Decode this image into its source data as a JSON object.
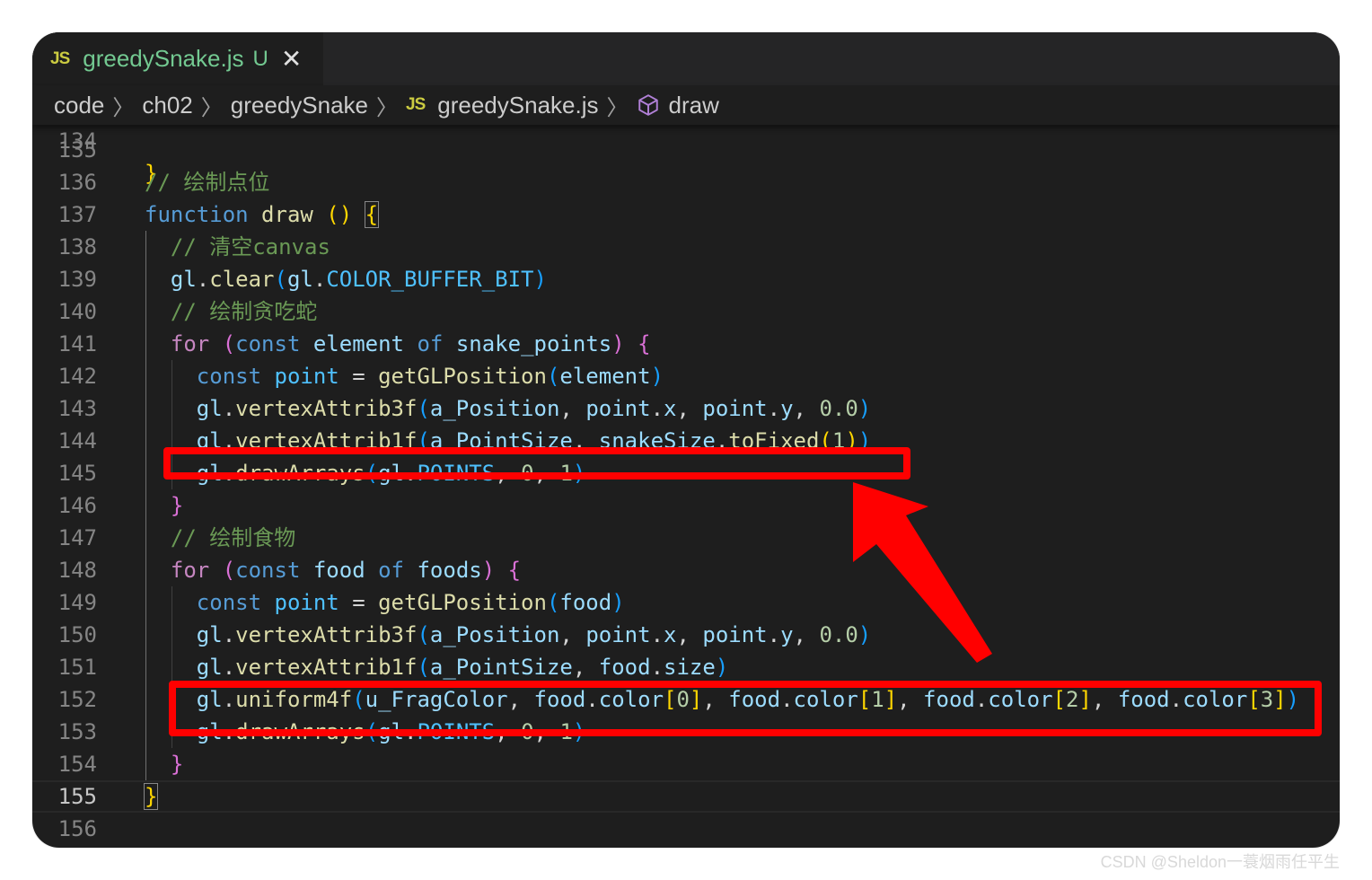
{
  "tab": {
    "icon": "JS",
    "filename": "greedySnake.js",
    "status": "U",
    "close_glyph": "✕"
  },
  "breadcrumb": {
    "segments": [
      "code",
      "ch02",
      "greedySnake"
    ],
    "file_icon": "JS",
    "file": "greedySnake.js",
    "symbol_icon": "cube-icon",
    "symbol": "draw",
    "separator": "〉"
  },
  "editor": {
    "current_line": "155",
    "lines": [
      {
        "n": "135"
      },
      {
        "n": "136"
      },
      {
        "n": "137"
      },
      {
        "n": "138"
      },
      {
        "n": "139"
      },
      {
        "n": "140"
      },
      {
        "n": "141"
      },
      {
        "n": "142"
      },
      {
        "n": "143"
      },
      {
        "n": "144"
      },
      {
        "n": "145"
      },
      {
        "n": "146"
      },
      {
        "n": "147"
      },
      {
        "n": "148"
      },
      {
        "n": "149"
      },
      {
        "n": "150"
      },
      {
        "n": "151"
      },
      {
        "n": "152"
      },
      {
        "n": "153"
      },
      {
        "n": "154"
      },
      {
        "n": "155"
      },
      {
        "n": "156"
      }
    ],
    "tokens": {
      "l136": [
        "// 绘制点位"
      ],
      "l137": [
        "function",
        " ",
        "draw",
        " ",
        "()",
        " ",
        "{"
      ],
      "l138": [
        "// 清空canvas"
      ],
      "l139": [
        "gl",
        ".",
        "clear",
        "(",
        "gl",
        ".",
        "COLOR_BUFFER_BIT",
        ")"
      ],
      "l140": [
        "// 绘制贪吃蛇"
      ],
      "l141": [
        "for",
        " ",
        "(",
        "const",
        " ",
        "element",
        " ",
        "of",
        " ",
        "snake_points",
        ")",
        " ",
        "{"
      ],
      "l142": [
        "const",
        " ",
        "point",
        " = ",
        "getGLPosition",
        "(",
        "element",
        ")"
      ],
      "l143": [
        "gl",
        ".",
        "vertexAttrib3f",
        "(",
        "a_Position",
        ", ",
        "point",
        ".",
        "x",
        ", ",
        "point",
        ".",
        "y",
        ", ",
        "0.0",
        ")"
      ],
      "l144": [
        "gl",
        ".",
        "vertexAttrib1f",
        "(",
        "a_PointSize",
        ", ",
        "snakeSize",
        ".",
        "toFixed",
        "(",
        "1",
        ")",
        ")"
      ],
      "l145": [
        "gl",
        ".",
        "drawArrays",
        "(",
        "gl",
        ".",
        "POINTS",
        ", ",
        "0",
        ", ",
        "1",
        ")"
      ],
      "l146": [
        "}"
      ],
      "l147": [
        "// 绘制食物"
      ],
      "l148": [
        "for",
        " ",
        "(",
        "const",
        " ",
        "food",
        " ",
        "of",
        " ",
        "foods",
        ")",
        " ",
        "{"
      ],
      "l149": [
        "const",
        " ",
        "point",
        " = ",
        "getGLPosition",
        "(",
        "food",
        ")"
      ],
      "l150": [
        "gl",
        ".",
        "vertexAttrib3f",
        "(",
        "a_Position",
        ", ",
        "point",
        ".",
        "x",
        ", ",
        "point",
        ".",
        "y",
        ", ",
        "0.0",
        ")"
      ],
      "l151": [
        "gl",
        ".",
        "vertexAttrib1f",
        "(",
        "a_PointSize",
        ", ",
        "food",
        ".",
        "size",
        ")"
      ],
      "l152": [
        "gl",
        ".",
        "uniform4f",
        "(",
        "u_FragColor",
        ", ",
        "food",
        ".",
        "color",
        "[",
        "0",
        "]",
        ", ",
        "food",
        ".",
        "color",
        "[",
        "1",
        "]",
        ", ",
        "food",
        ".",
        "color",
        "[",
        "2",
        "]",
        ", ",
        "food",
        ".",
        "color",
        "[",
        "3",
        "]",
        ")"
      ],
      "l153": [
        "gl",
        ".",
        "drawArrays",
        "(",
        "gl",
        ".",
        "POINTS",
        ", ",
        "0",
        ", ",
        "1",
        ")"
      ],
      "l154": [
        "}"
      ],
      "l155": [
        "}"
      ]
    }
  },
  "watermark": "CSDN @Sheldon一蓑烟雨任平生",
  "colors": {
    "annotation": "#ff0000",
    "tab_modified": "#73c991",
    "js_icon": "#cbcb41"
  }
}
